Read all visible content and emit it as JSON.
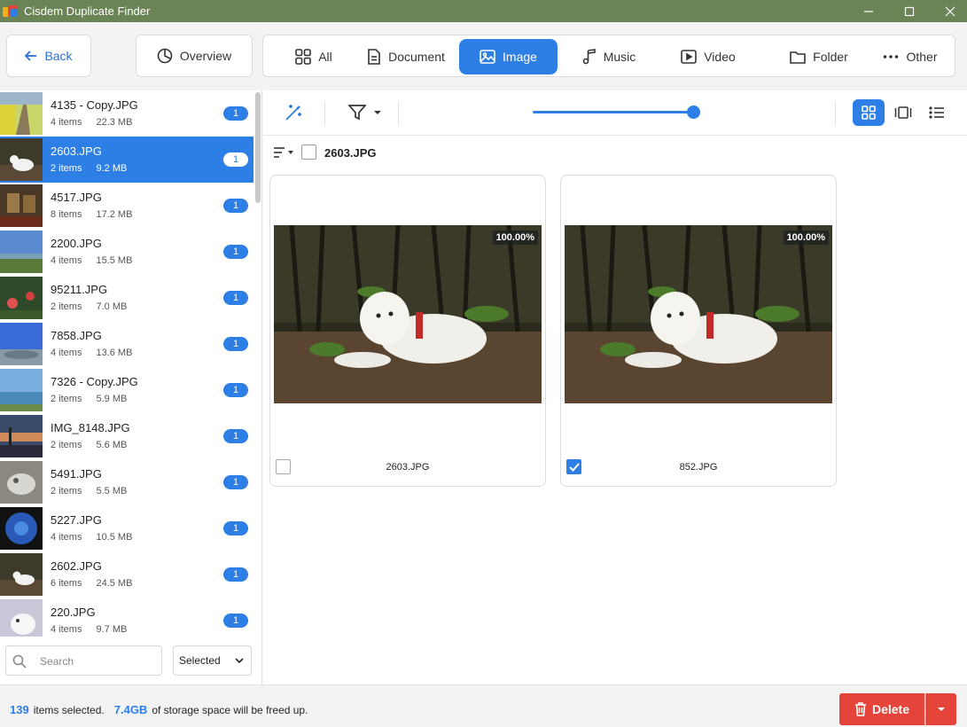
{
  "window": {
    "title": "Cisdem Duplicate Finder",
    "controls": [
      "minimize-icon",
      "maximize-icon",
      "close-icon"
    ]
  },
  "nav": {
    "back_label": "Back",
    "overview_label": "Overview",
    "tabs": [
      {
        "label": "All",
        "icon": "grid-icon",
        "active": false
      },
      {
        "label": "Document",
        "icon": "document-icon",
        "active": false
      },
      {
        "label": "Image",
        "icon": "image-icon",
        "active": true
      },
      {
        "label": "Music",
        "icon": "music-icon",
        "active": false
      },
      {
        "label": "Video",
        "icon": "video-icon",
        "active": false
      },
      {
        "label": "Folder",
        "icon": "folder-icon",
        "active": false
      },
      {
        "label": "Other",
        "icon": "more-icon",
        "active": false
      }
    ]
  },
  "sidebar": {
    "items": [
      {
        "name": "4135 - Copy.JPG",
        "count": "4 items",
        "size": "22.3 MB",
        "badge": "1",
        "selected": false
      },
      {
        "name": "2603.JPG",
        "count": "2 items",
        "size": "9.2 MB",
        "badge": "1",
        "selected": true
      },
      {
        "name": "4517.JPG",
        "count": "8 items",
        "size": "17.2 MB",
        "badge": "1",
        "selected": false
      },
      {
        "name": "2200.JPG",
        "count": "4 items",
        "size": "15.5 MB",
        "badge": "1",
        "selected": false
      },
      {
        "name": "95211.JPG",
        "count": "2 items",
        "size": "7.0 MB",
        "badge": "1",
        "selected": false
      },
      {
        "name": "7858.JPG",
        "count": "4 items",
        "size": "13.6 MB",
        "badge": "1",
        "selected": false
      },
      {
        "name": "7326 - Copy.JPG",
        "count": "2 items",
        "size": "5.9 MB",
        "badge": "1",
        "selected": false
      },
      {
        "name": "IMG_8148.JPG",
        "count": "2 items",
        "size": "5.6 MB",
        "badge": "1",
        "selected": false
      },
      {
        "name": "5491.JPG",
        "count": "2 items",
        "size": "5.5 MB",
        "badge": "1",
        "selected": false
      },
      {
        "name": "5227.JPG",
        "count": "4 items",
        "size": "10.5 MB",
        "badge": "1",
        "selected": false
      },
      {
        "name": "2602.JPG",
        "count": "6 items",
        "size": "24.5 MB",
        "badge": "1",
        "selected": false
      },
      {
        "name": "220.JPG",
        "count": "4 items",
        "size": "9.7 MB",
        "badge": "1",
        "selected": false
      }
    ],
    "search_placeholder": "Search",
    "filter_value": "Selected"
  },
  "main": {
    "group_title": "2603.JPG",
    "zoom_level": 1.0,
    "cards": [
      {
        "filename": "2603.JPG",
        "similarity": "100.00%",
        "checked": false
      },
      {
        "filename": "852.JPG",
        "similarity": "100.00%",
        "checked": true
      }
    ]
  },
  "status": {
    "selected_count": "139",
    "items_text": "items selected.",
    "freed_size": "7.4GB",
    "freed_text": "of storage space will be freed up.",
    "delete_label": "Delete"
  },
  "colors": {
    "accent": "#2d7fe6",
    "titlebar": "#6b8456",
    "delete": "#e5443a"
  }
}
